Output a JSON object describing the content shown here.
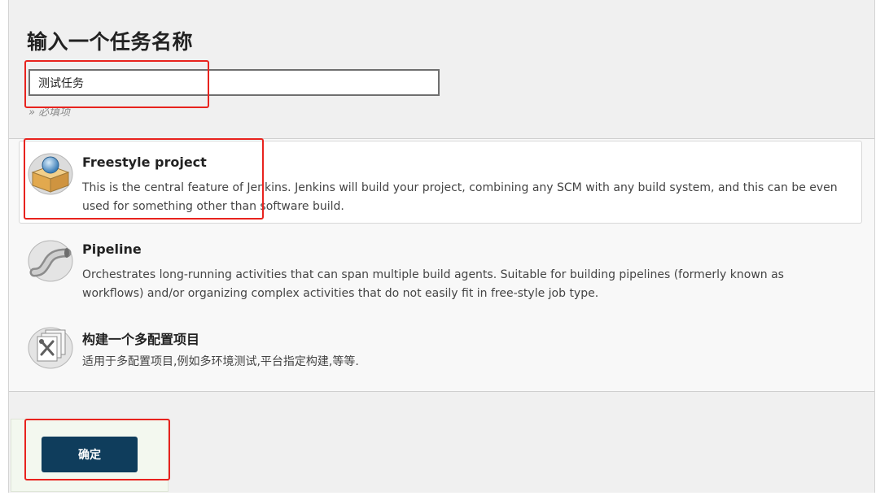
{
  "header": {
    "title": "输入一个任务名称",
    "name_input_value": "测试任务",
    "required_hint": "» 必填项"
  },
  "items": [
    {
      "title": "Freestyle project",
      "description": "This is the central feature of Jenkins. Jenkins will build your project, combining any SCM with any build system, and this can be even used for something other than software build.",
      "icon": "freestyle-box-icon",
      "selected": true
    },
    {
      "title": "Pipeline",
      "description": "Orchestrates long-running activities that can span multiple build agents. Suitable for building pipelines (formerly known as workflows) and/or organizing complex activities that do not easily fit in free-style job type.",
      "icon": "pipeline-icon",
      "selected": false
    },
    {
      "title": "构建一个多配置项目",
      "description": "适用于多配置项目,例如多环境测试,平台指定构建,等等.",
      "icon": "multi-config-icon",
      "selected": false
    }
  ],
  "footer": {
    "ok_label": "确定"
  },
  "colors": {
    "ok_button": "#0f3d5c",
    "highlight": "#e8231e",
    "panel_bg": "#f0f0f0"
  }
}
